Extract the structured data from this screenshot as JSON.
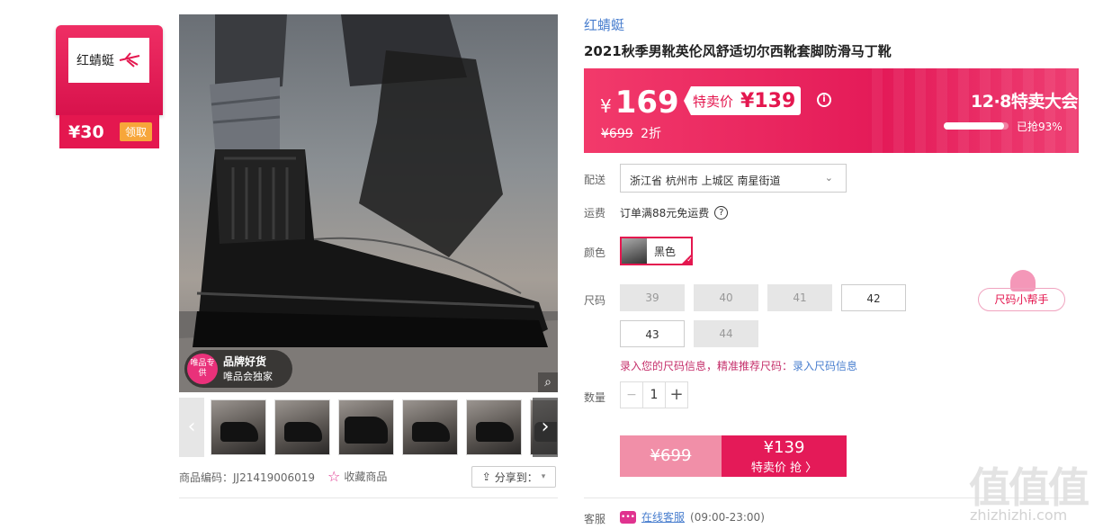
{
  "coupon": {
    "brand": "红蜻蜓",
    "amount": "¥30",
    "get_label": "领取"
  },
  "gallery": {
    "badge_logo": "唯品专供",
    "badge_line1": "品牌好货",
    "badge_line2": "唯品会独家",
    "zoom_icon": "magnifier-icon",
    "prev_icon": "chevron-left-icon",
    "next_icon": "chevron-right-icon",
    "thumbnail_count": 6
  },
  "meta": {
    "code": "商品编码：JJ21419006019",
    "favorite": "收藏商品",
    "share": "分享到："
  },
  "product": {
    "brand": "红蜻蜓",
    "title": "2021秋季男靴英伦风舒适切尔西靴套脚防滑马丁靴"
  },
  "price": {
    "currency": "¥",
    "price": "169",
    "special_label": "特卖价",
    "special_price": "¥139",
    "original": "¥699",
    "discount": "2折",
    "sale_title": "12·8特卖大会",
    "sold_text": "已抢93%",
    "sold_fraction": 0.93,
    "accent": "#e4174f"
  },
  "shipping": {
    "label": "配送",
    "address": "浙江省 杭州市 上城区 南星街道"
  },
  "fee": {
    "label": "运费",
    "text": "订单满88元免运费"
  },
  "color": {
    "label": "颜色",
    "selected": "黑色"
  },
  "size": {
    "label": "尺码",
    "options": [
      {
        "v": "39",
        "ok": false
      },
      {
        "v": "40",
        "ok": false
      },
      {
        "v": "41",
        "ok": false
      },
      {
        "v": "42",
        "ok": true
      },
      {
        "v": "43",
        "ok": true
      },
      {
        "v": "44",
        "ok": false
      }
    ],
    "helper": "尺码小帮手",
    "info_text": "录入您的尺码信息，精准推荐尺码：",
    "info_link": "录入尺码信息"
  },
  "quantity": {
    "label": "数量",
    "value": "1",
    "minus": "−",
    "plus": "+"
  },
  "buy": {
    "original": "¥699",
    "price": "¥139",
    "action": "特卖价 抢 〉"
  },
  "service": {
    "label": "客服",
    "link": "在线客服",
    "hours": "(09:00-23:00)"
  },
  "watermark": {
    "logo": "值值值",
    "site": "zhizhizhi.com"
  }
}
